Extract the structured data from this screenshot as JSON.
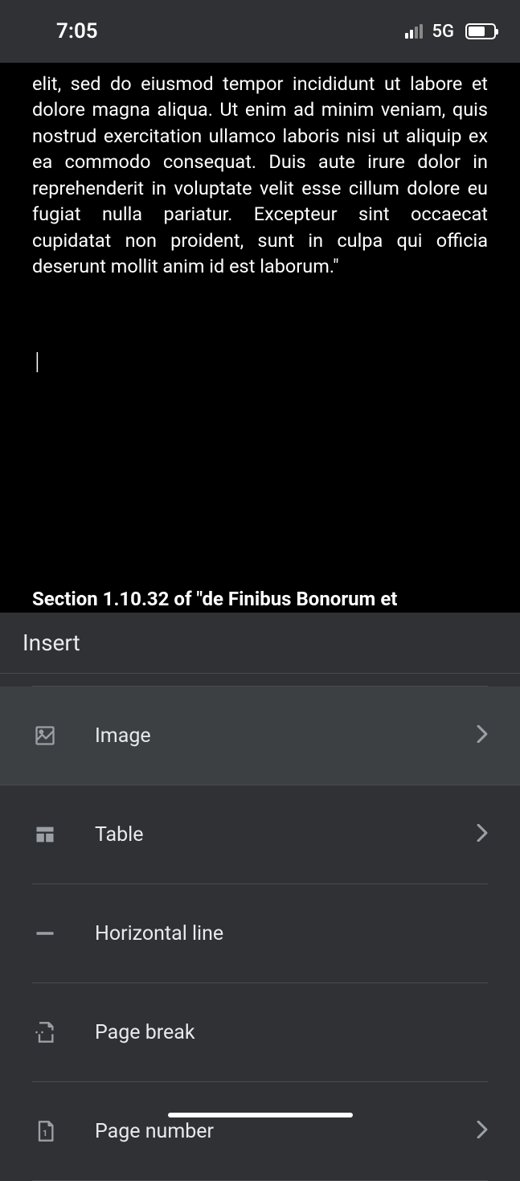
{
  "statusBar": {
    "time": "7:05",
    "network": "5G"
  },
  "document": {
    "bodyText": "elit, sed do eiusmod tempor incididunt ut labore et dolore magna aliqua. Ut enim ad minim veniam, quis nostrud exercitation ullamco laboris nisi ut aliquip ex ea commodo consequat. Duis aute irure dolor in reprehenderit in voluptate velit esse cillum dolore eu fugiat nulla pariatur. Excepteur sint occaecat cupidatat non proident, sunt in culpa qui officia deserunt mollit anim id est laborum.\"",
    "sectionHeading": "Section 1.10.32 of \"de Finibus Bonorum et"
  },
  "panel": {
    "title": "Insert",
    "items": [
      {
        "label": "Image",
        "icon": "image-icon",
        "hasChevron": true,
        "highlighted": true
      },
      {
        "label": "Table",
        "icon": "table-icon",
        "hasChevron": true,
        "highlighted": false
      },
      {
        "label": "Horizontal line",
        "icon": "horizontal-line-icon",
        "hasChevron": false,
        "highlighted": false
      },
      {
        "label": "Page break",
        "icon": "page-break-icon",
        "hasChevron": false,
        "highlighted": false
      },
      {
        "label": "Page number",
        "icon": "page-number-icon",
        "hasChevron": true,
        "highlighted": false
      }
    ]
  }
}
